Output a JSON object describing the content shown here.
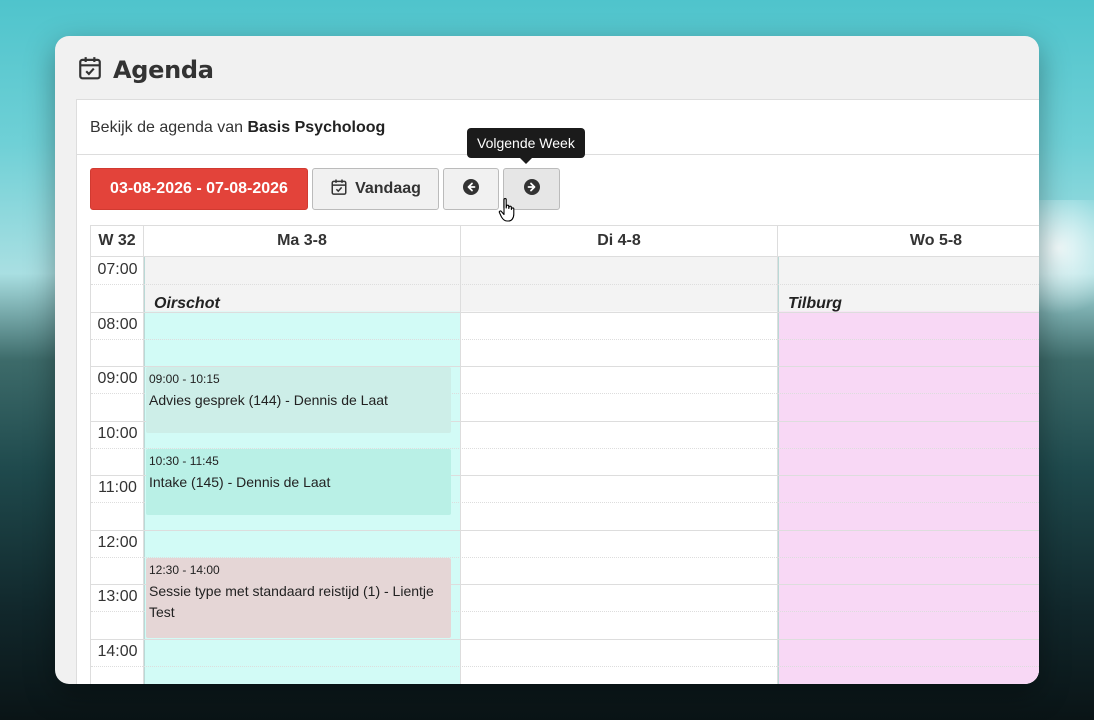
{
  "page": {
    "title": "Agenda",
    "subtitle_prefix": "Bekijk de agenda van",
    "subtitle_name": "Basis Psycholoog"
  },
  "toolbar": {
    "date_range": "03-08-2026 - 07-08-2026",
    "today_label": "Vandaag",
    "prev_icon": "arrow-left-circle-icon",
    "next_icon": "arrow-right-circle-icon",
    "tooltip": "Volgende Week"
  },
  "calendar": {
    "week_label": "W 32",
    "days": [
      {
        "label": "Ma 3-8",
        "location": "Oirschot",
        "color": "#d2fbf6"
      },
      {
        "label": "Di 4-8",
        "location": "",
        "color": "#ffffff"
      },
      {
        "label": "Wo 5-8",
        "location": "Tilburg",
        "color": "#f8d8f5"
      }
    ],
    "times": [
      "07:00",
      "08:00",
      "09:00",
      "10:00",
      "11:00",
      "12:00",
      "13:00",
      "14:00"
    ],
    "events": [
      {
        "day": 0,
        "start": "09:00",
        "end": "10:15",
        "time": "09:00 - 10:15",
        "title": "Advies gesprek (144) - Dennis de Laat",
        "color": "#cdeee8"
      },
      {
        "day": 0,
        "start": "10:30",
        "end": "11:45",
        "time": "10:30 - 11:45",
        "title": "Intake (145) - Dennis de Laat",
        "color": "#b9f0e6"
      },
      {
        "day": 0,
        "start": "12:30",
        "end": "14:00",
        "time": "12:30 - 14:00",
        "title": "Sessie type met standaard reistijd (1) - Lientje Test",
        "color": "#e5d6d6"
      }
    ]
  },
  "colors": {
    "accent": "#e3433a",
    "unavailable_bg": "#f3f3f3"
  }
}
